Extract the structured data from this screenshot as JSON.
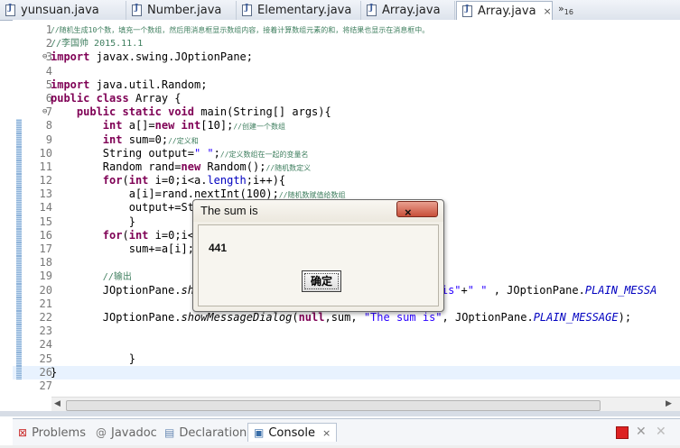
{
  "editor_tabs": [
    {
      "label": "yunsuan.java",
      "closable": false
    },
    {
      "label": "Number.java",
      "closable": false
    },
    {
      "label": "Elementary.java",
      "closable": false
    },
    {
      "label": "Array.java",
      "closable": false
    },
    {
      "label": "Array.java",
      "closable": true,
      "active": true
    }
  ],
  "more_tabs": {
    "marker": "»",
    "count": "16"
  },
  "code_lines": [
    "1",
    "2",
    "3",
    "4",
    "5",
    "6",
    "7",
    "8",
    "9",
    "10",
    "11",
    "12",
    "13",
    "14",
    "15",
    "16",
    "17",
    "18",
    "19",
    "20",
    "21",
    "22",
    "23",
    "24",
    "25",
    "26",
    "27"
  ],
  "code": {
    "l1_comment": "//随机生成10个数，填充一个数组，然后用消息框显示数组内容，接着计算数组元素的和，将结果也显示在消息框中。",
    "l2_comment": "//李国帅 2015.11.1",
    "l3": "JOptionPane;",
    "l3_kw": "import",
    "l3_pkg": "javax.swing.",
    "l5_kw": "import",
    "l5": "java.util.Random;",
    "l6_kw1": "public",
    "l6_kw2": "class",
    "l6": "Array {",
    "l7_kw1": "public",
    "l7_kw2": "static",
    "l7_kw3": "void",
    "l7": "main(String[] args){",
    "l8_kw1": "int",
    "l8_a": "a[]=",
    "l8_kw2": "new",
    "l8_kw3": "int",
    "l8_b": "[10];",
    "l8_comment": "//创建一个数组",
    "l9_kw": "int",
    "l9": "sum=0;",
    "l9_comment": "//定义和",
    "l10_a": "String",
    "l10_b": "output=",
    "l10_str": "\" \"",
    "l10_c": ";",
    "l10_comment": "//定义数组在一起的变量名",
    "l11_a": "Random rand=",
    "l11_kw": "new",
    "l11_b": "Random();",
    "l11_comment": "//随机数定义",
    "l12_kw1": "for",
    "l12_a": "(",
    "l12_kw2": "int",
    "l12_b": "i=0;i<a.",
    "l12_fld": "length",
    "l12_c": ";i++){",
    "l13": "a[i]=rand.nextInt(100);",
    "l13_comment": "//随机数赋值给数组",
    "l14": "output+=Str",
    "l15": "}",
    "l16_kw1": "for",
    "l16_a": "(",
    "l16_kw2": "int",
    "l16_b": "i=0;i<a",
    "l17": "sum+=a[i];",
    "l19_comment": "//输出",
    "l20_a": "JOptionPane.",
    "l20_it": "sho",
    "l20_str": "er is\"",
    "l20_b": "+",
    "l20_str2": "\" \"",
    "l20_c": ", JOptionPane.",
    "l20_sfi": "PLAIN_MESSA",
    "l22_a": "JOptionPane.",
    "l22_it": "showMessageDialog",
    "l22_b": "(",
    "l22_kw": "null",
    "l22_c": ",sum,",
    "l22_str": "\"The sum is\"",
    "l22_d": ", JOptionPane.",
    "l22_sfi": "PLAIN_MESSAGE",
    "l22_e": ");",
    "l25": "}",
    "l26": "}"
  },
  "dialog": {
    "title": "The sum is",
    "close_glyph": "×",
    "message": "441",
    "ok_label": "确定"
  },
  "bottom_views": {
    "problems": "Problems",
    "javadoc": "Javadoc",
    "declaration": "Declaration",
    "console": "Console",
    "console_close": "×"
  },
  "colors": {
    "keyword": "#7f0055",
    "comment": "#3f7f5f",
    "string": "#2a00ff",
    "field": "#0000c0",
    "current_line": "#e8f2fe"
  }
}
